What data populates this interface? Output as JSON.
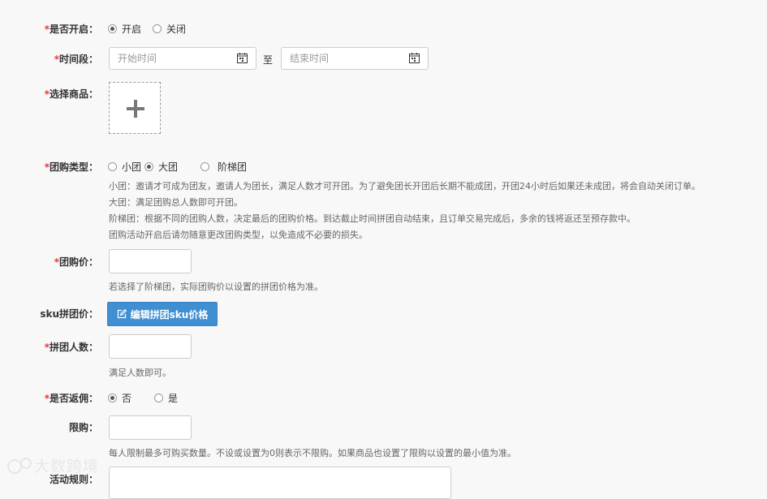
{
  "enable": {
    "label": "是否开启：",
    "options": [
      "开启",
      "关闭"
    ],
    "selected": 0
  },
  "period": {
    "label": "时间段：",
    "start_placeholder": "开始时间",
    "end_placeholder": "结束时间",
    "to": "至"
  },
  "product": {
    "label": "选择商品："
  },
  "group_type": {
    "label": "团购类型：",
    "options": [
      "小团",
      "大团",
      "阶梯团"
    ],
    "selected": 1,
    "help": [
      "小团：邀请才可成为团友，邀请人为团长，满足人数才可开团。为了避免团长开团后长期不能成团，开团24小时后如果还未成团，将会自动关闭订单。",
      "大团：满足团购总人数即可开团。",
      "阶梯团：根据不同的团购人数，决定最后的团购价格。到达截止时间拼团自动结束，且订单交易完成后，多余的钱将返还至预存款中。",
      "团购活动开启后请勿随意更改团购类型，以免造成不必要的损失。"
    ]
  },
  "group_price": {
    "label": "团购价：",
    "value": "",
    "help": "若选择了阶梯团，实际团购价以设置的拼团价格为准。"
  },
  "sku_price": {
    "label": "sku拼团价：",
    "button": "编辑拼团sku价格"
  },
  "group_size": {
    "label": "拼团人数：",
    "value": "",
    "help": "满足人数即可。"
  },
  "commission": {
    "label": "是否返佣：",
    "options": [
      "否",
      "是"
    ],
    "selected": 0
  },
  "limit": {
    "label": "限购：",
    "value": "",
    "help": "每人限制最多可购买数量。不设或设置为0则表示不限购。如果商品也设置了限购以设置的最小值为准。"
  },
  "rules": {
    "label": "活动规则："
  },
  "watermark": {
    "text": "大数跨境"
  },
  "colors": {
    "required": "#e4393c",
    "primary_button": "#3f8fd2"
  }
}
